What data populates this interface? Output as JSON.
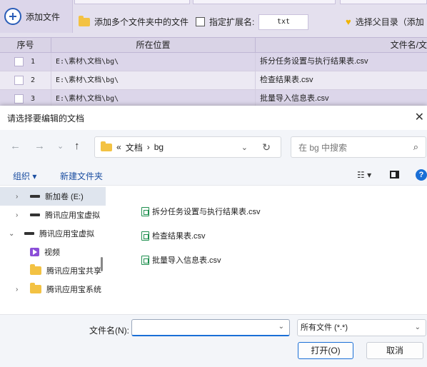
{
  "app": {
    "toolbar": {
      "add_file": "添加文件",
      "add_multi_folder": "添加多个文件夹中的文件",
      "specify_ext_label": "指定扩展名:",
      "ext_value": "txt",
      "choose_parent": "选择父目录（添加"
    },
    "grid": {
      "columns": [
        "序号",
        "所在位置",
        "文件名/文"
      ],
      "rows": [
        {
          "num": "1",
          "path": "E:\\素材\\文档\\bg\\",
          "name": "拆分任务设置与执行结果表.csv"
        },
        {
          "num": "2",
          "path": "E:\\素材\\文档\\bg\\",
          "name": "检查结果表.csv"
        },
        {
          "num": "3",
          "path": "E:\\素材\\文档\\bg\\",
          "name": "批量导入信息表.csv"
        }
      ]
    }
  },
  "dialog": {
    "title": "请选择要编辑的文档",
    "breadcrumb": [
      "«",
      "文档",
      "›",
      "bg"
    ],
    "search_placeholder": "在 bg 中搜索",
    "organize": "组织 ▾",
    "new_folder": "新建文件夹",
    "tree": [
      {
        "label": "新加卷 (E:)",
        "type": "drive",
        "arrow": "›"
      },
      {
        "label": "腾讯应用宝虚拟",
        "type": "drive",
        "arrow": "›"
      },
      {
        "label": "腾讯应用宝虚拟",
        "type": "drive",
        "arrow": "⌄"
      },
      {
        "label": "视频",
        "type": "video",
        "arrow": ""
      },
      {
        "label": "腾讯应用宝共享",
        "type": "folder",
        "arrow": ""
      },
      {
        "label": "腾讯应用宝系统",
        "type": "folder",
        "arrow": "›"
      }
    ],
    "files": [
      "拆分任务设置与执行结果表.csv",
      "检查结果表.csv",
      "批量导入信息表.csv"
    ],
    "filename_label": "文件名(N):",
    "filename_value": "",
    "filetype": "所有文件 (*.*)",
    "open_button": "打开(O)",
    "cancel_button": "取消"
  },
  "colors": {
    "accent": "#1a6fd6",
    "link": "#1b4ea1",
    "app_bg": "#eae7f1",
    "header_bg": "#d9d3e6"
  }
}
